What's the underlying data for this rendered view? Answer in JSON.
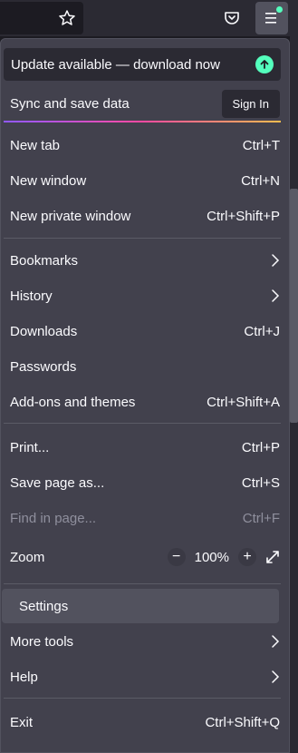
{
  "menu": {
    "update_label": "Update available — download now",
    "sync_label": "Sync and save data",
    "signin_label": "Sign In",
    "items": [
      {
        "label": "New tab",
        "shortcut": "Ctrl+T"
      },
      {
        "label": "New window",
        "shortcut": "Ctrl+N"
      },
      {
        "label": "New private window",
        "shortcut": "Ctrl+Shift+P"
      },
      {
        "label": "Bookmarks",
        "shortcut": ""
      },
      {
        "label": "History",
        "shortcut": ""
      },
      {
        "label": "Downloads",
        "shortcut": "Ctrl+J"
      },
      {
        "label": "Passwords",
        "shortcut": ""
      },
      {
        "label": "Add-ons and themes",
        "shortcut": "Ctrl+Shift+A"
      },
      {
        "label": "Print...",
        "shortcut": "Ctrl+P"
      },
      {
        "label": "Save page as...",
        "shortcut": "Ctrl+S"
      },
      {
        "label": "Find in page...",
        "shortcut": "Ctrl+F"
      },
      {
        "label": "Zoom",
        "shortcut": ""
      },
      {
        "label": "Settings",
        "shortcut": ""
      },
      {
        "label": "More tools",
        "shortcut": ""
      },
      {
        "label": "Help",
        "shortcut": ""
      },
      {
        "label": "Exit",
        "shortcut": "Ctrl+Shift+Q"
      }
    ],
    "zoom_value": "100%",
    "zoom_minus": "−",
    "zoom_plus": "+"
  },
  "colors": {
    "menu_bg": "#42414d",
    "accent_green": "#54ffbd",
    "disabled_text": "#8f8f9d"
  },
  "icons": [
    "star-icon",
    "pocket-icon",
    "hamburger-menu-icon",
    "update-arrow-icon",
    "chevron-right-icon",
    "fullscreen-icon"
  ]
}
